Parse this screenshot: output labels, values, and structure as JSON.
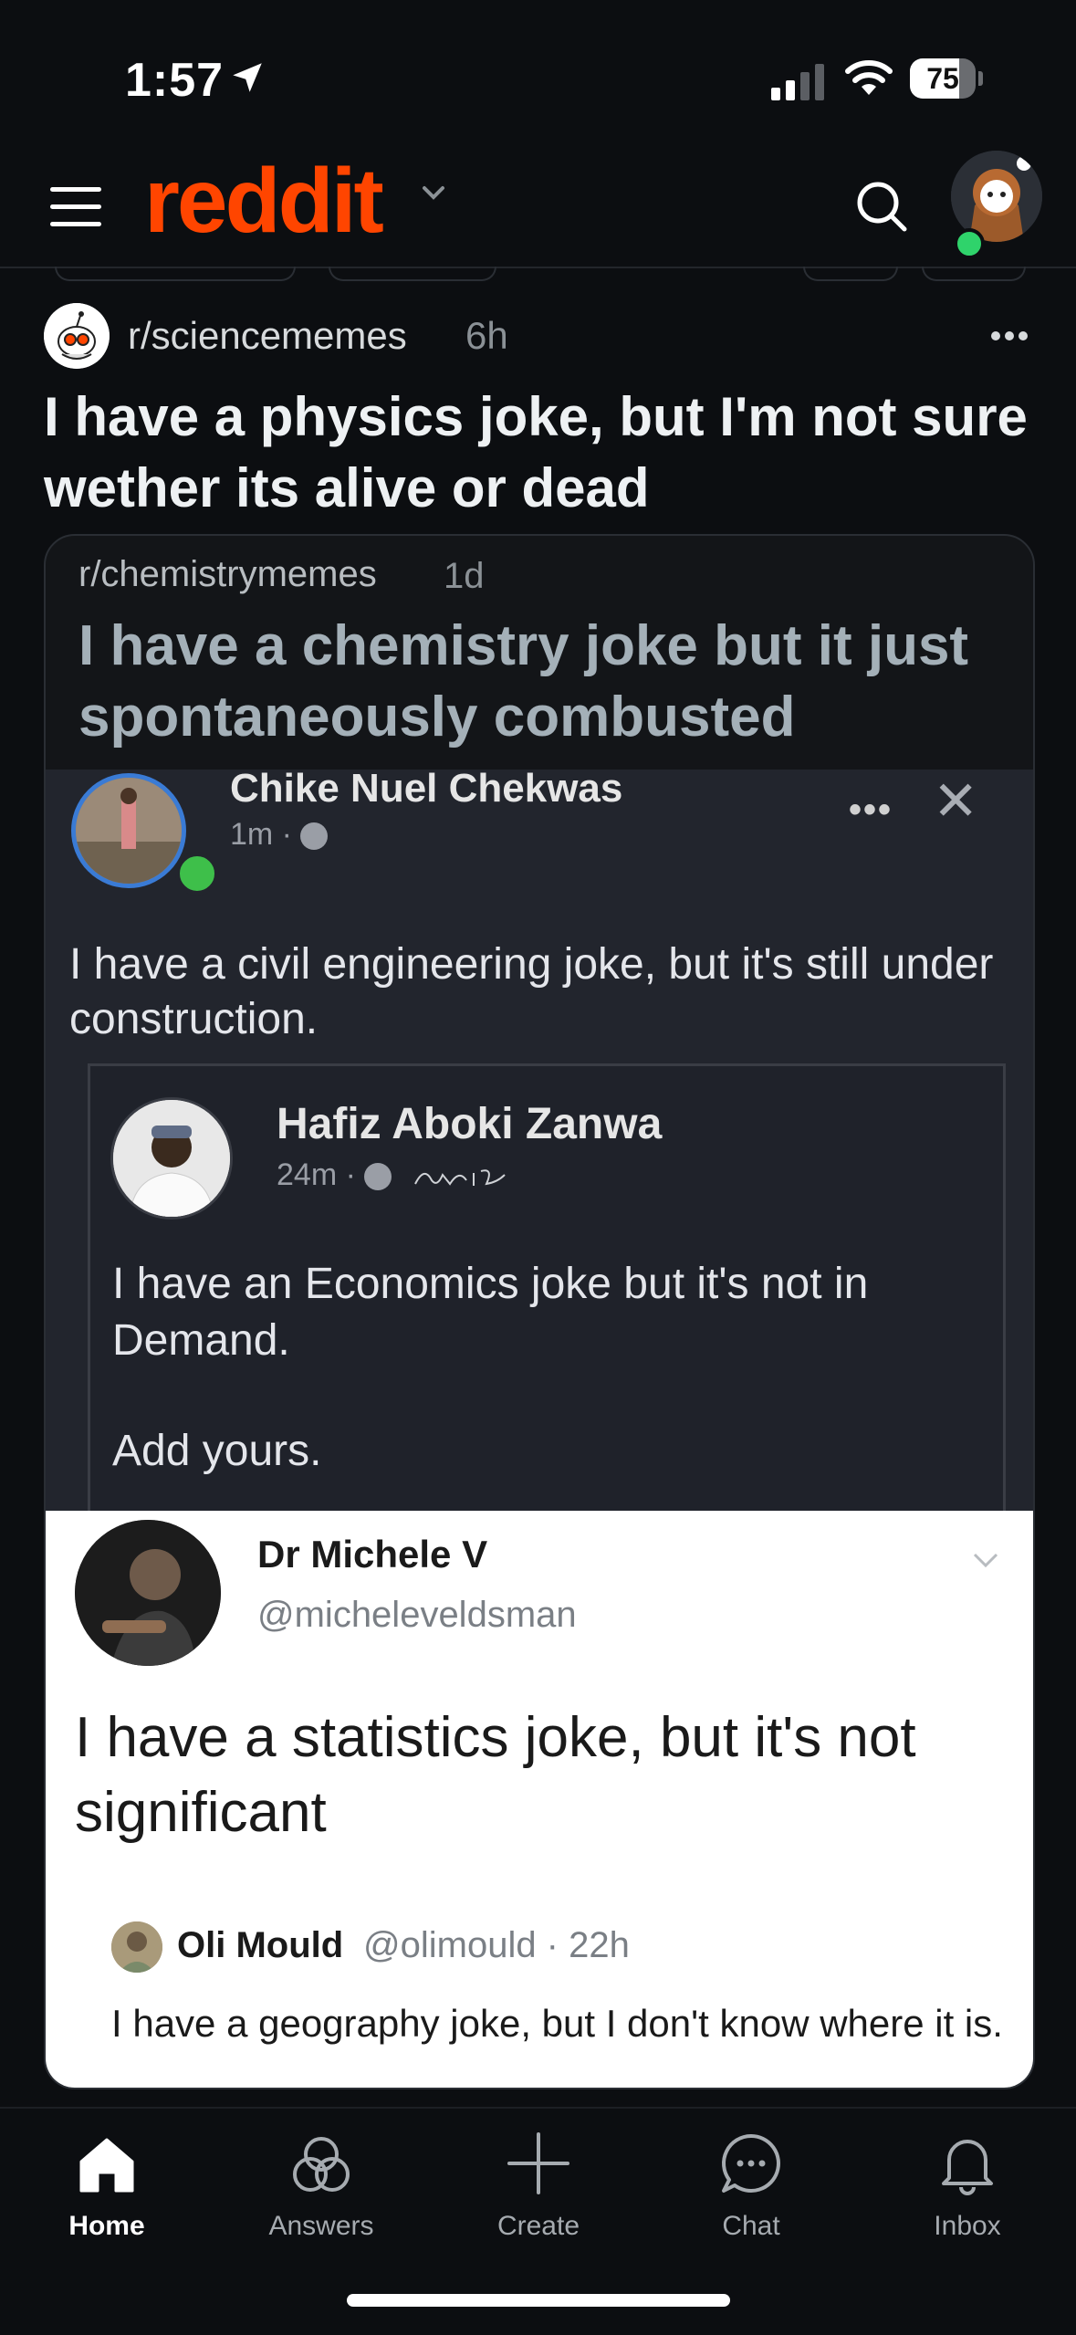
{
  "status_bar": {
    "time": "1:57",
    "battery": "75",
    "battery_level": 0.75
  },
  "header": {
    "logo": "reddit"
  },
  "post": {
    "subreddit": "r/sciencememes",
    "age": "6h",
    "title": "I have a physics joke, but I'm not sure wether its alive or dead"
  },
  "crosspost": {
    "subreddit": "r/chemistrymemes",
    "age": "1d",
    "title": "I have a chemistry joke but it just spontaneously combusted"
  },
  "meme": {
    "fb_post": {
      "author": "Chike Nuel Chekwas",
      "meta": "1m · ",
      "text": "I have a civil engineering joke, but it's still under construction.",
      "shared": {
        "author": "Hafiz Aboki Zanwa",
        "meta": "24m · ",
        "text": "I have an Economics joke but it's not in Demand.",
        "text2": "Add yours."
      }
    },
    "tweet": {
      "author": "Dr Michele V",
      "handle": "@micheleveldsman",
      "text": "I have a statistics joke, but it's not significant",
      "quote": {
        "author": "Oli Mould",
        "handle": "@olimould · 22h",
        "text": "I have a geography joke, but I don't know where it is."
      }
    }
  },
  "tabs": [
    {
      "label": "Home",
      "icon": "home-icon",
      "active": true
    },
    {
      "label": "Answers",
      "icon": "answers-icon",
      "active": false
    },
    {
      "label": "Create",
      "icon": "plus-icon",
      "active": false
    },
    {
      "label": "Chat",
      "icon": "chat-icon",
      "active": false
    },
    {
      "label": "Inbox",
      "icon": "bell-icon",
      "active": false
    }
  ],
  "colors": {
    "brand": "#ff4500",
    "background": "#0c0e11",
    "online": "#2fd36b"
  }
}
